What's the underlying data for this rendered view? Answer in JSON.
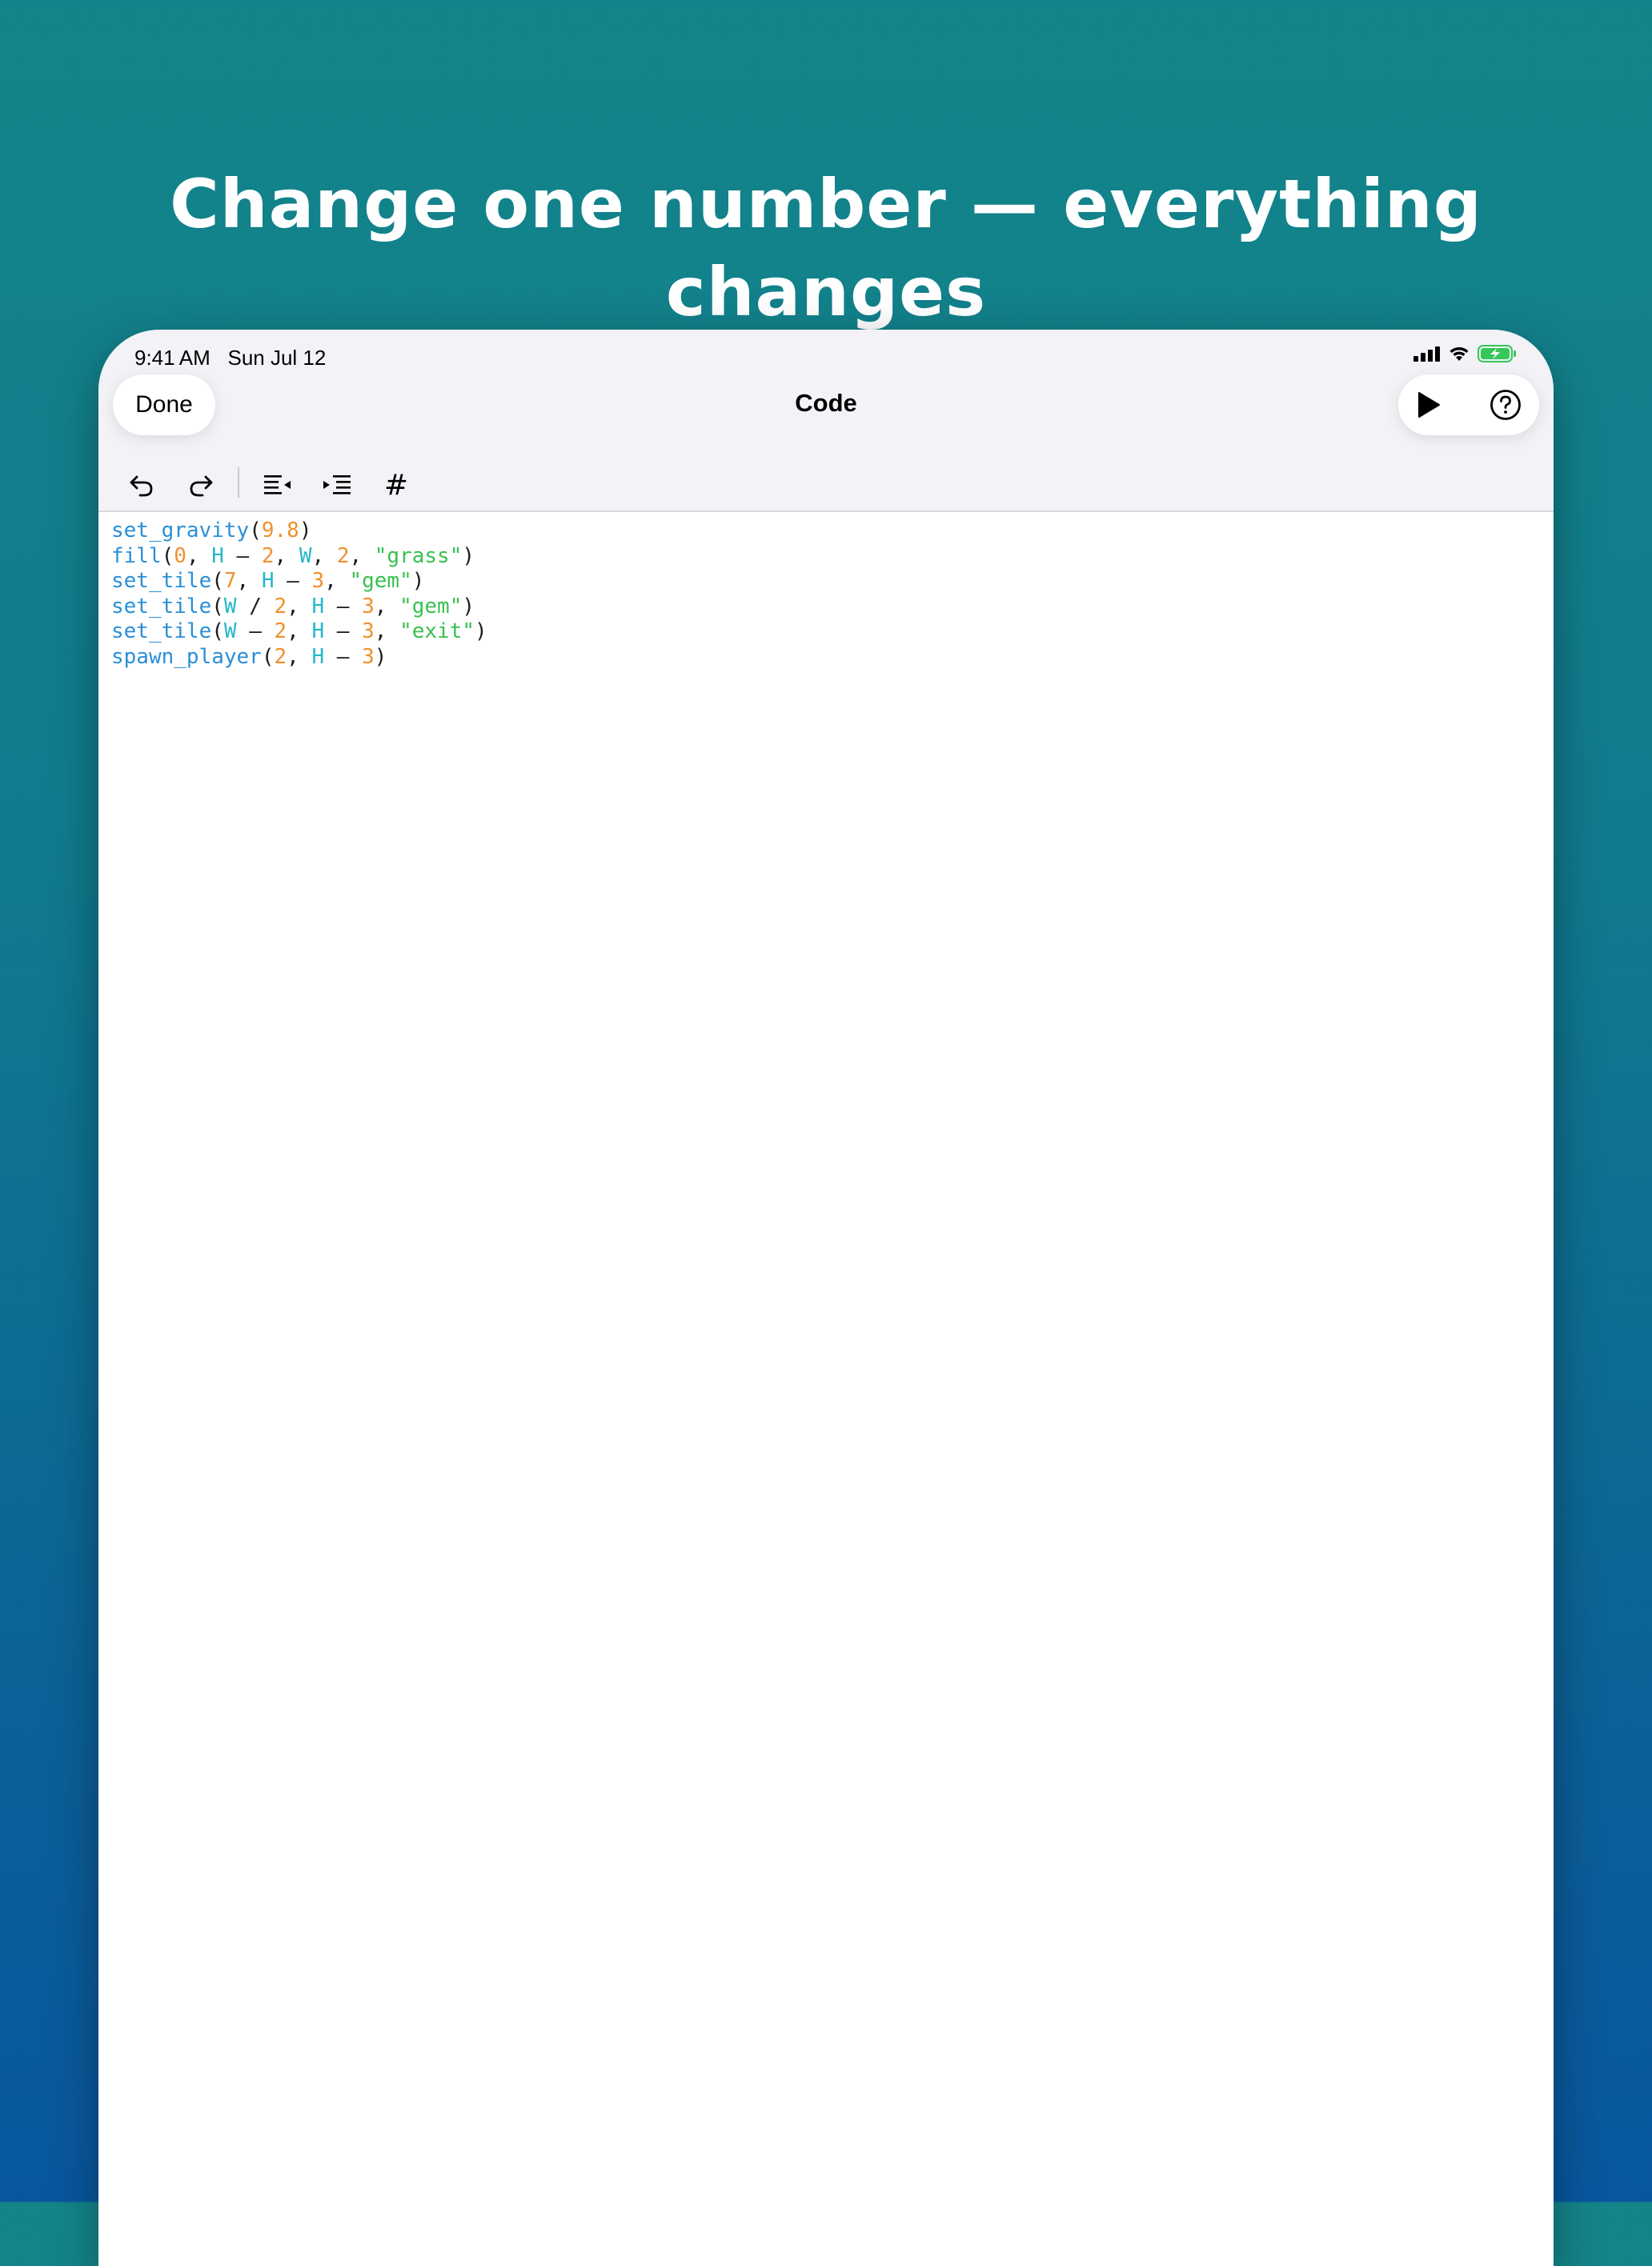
{
  "headline": "Change one number — everything changes",
  "status_bar": {
    "time": "9:41 AM",
    "date": "Sun Jul 12",
    "icons": [
      "cellular-signal-icon",
      "wifi-icon",
      "battery-charging-icon"
    ]
  },
  "nav": {
    "done_label": "Done",
    "title": "Code",
    "run_icon": "play-icon",
    "help_icon": "question-circle-icon"
  },
  "toolbar": {
    "icons": [
      "undo-icon",
      "redo-icon",
      "outdent-icon",
      "indent-icon",
      "comment-hash-icon"
    ],
    "hash_label": "#"
  },
  "colors": {
    "function": "#2b8fd6",
    "number": "#f0902c",
    "variable": "#25b7c9",
    "string": "#38c150",
    "punctuation": "#1c1c1e",
    "battery_green": "#34c759"
  },
  "code_lines": [
    [
      [
        "fn",
        "set_gravity"
      ],
      [
        "pun",
        "("
      ],
      [
        "num",
        "9.8"
      ],
      [
        "pun",
        ")"
      ]
    ],
    [
      [
        "fn",
        "fill"
      ],
      [
        "pun",
        "("
      ],
      [
        "num",
        "0"
      ],
      [
        "pun",
        ", "
      ],
      [
        "var",
        "H"
      ],
      [
        "pun",
        " – "
      ],
      [
        "num",
        "2"
      ],
      [
        "pun",
        ", "
      ],
      [
        "var",
        "W"
      ],
      [
        "pun",
        ", "
      ],
      [
        "num",
        "2"
      ],
      [
        "pun",
        ", "
      ],
      [
        "str",
        "\"grass\""
      ],
      [
        "pun",
        ")"
      ]
    ],
    [
      [
        "fn",
        "set_tile"
      ],
      [
        "pun",
        "("
      ],
      [
        "num",
        "7"
      ],
      [
        "pun",
        ", "
      ],
      [
        "var",
        "H"
      ],
      [
        "pun",
        " – "
      ],
      [
        "num",
        "3"
      ],
      [
        "pun",
        ", "
      ],
      [
        "str",
        "\"gem\""
      ],
      [
        "pun",
        ")"
      ]
    ],
    [
      [
        "fn",
        "set_tile"
      ],
      [
        "pun",
        "("
      ],
      [
        "var",
        "W"
      ],
      [
        "pun",
        " / "
      ],
      [
        "num",
        "2"
      ],
      [
        "pun",
        ", "
      ],
      [
        "var",
        "H"
      ],
      [
        "pun",
        " – "
      ],
      [
        "num",
        "3"
      ],
      [
        "pun",
        ", "
      ],
      [
        "str",
        "\"gem\""
      ],
      [
        "pun",
        ")"
      ]
    ],
    [
      [
        "fn",
        "set_tile"
      ],
      [
        "pun",
        "("
      ],
      [
        "var",
        "W"
      ],
      [
        "pun",
        " – "
      ],
      [
        "num",
        "2"
      ],
      [
        "pun",
        ", "
      ],
      [
        "var",
        "H"
      ],
      [
        "pun",
        " – "
      ],
      [
        "num",
        "3"
      ],
      [
        "pun",
        ", "
      ],
      [
        "str",
        "\"exit\""
      ],
      [
        "pun",
        ")"
      ]
    ],
    [
      [
        "fn",
        "spawn_player"
      ],
      [
        "pun",
        "("
      ],
      [
        "num",
        "2"
      ],
      [
        "pun",
        ", "
      ],
      [
        "var",
        "H"
      ],
      [
        "pun",
        " – "
      ],
      [
        "num",
        "3"
      ],
      [
        "pun",
        ")"
      ]
    ]
  ]
}
